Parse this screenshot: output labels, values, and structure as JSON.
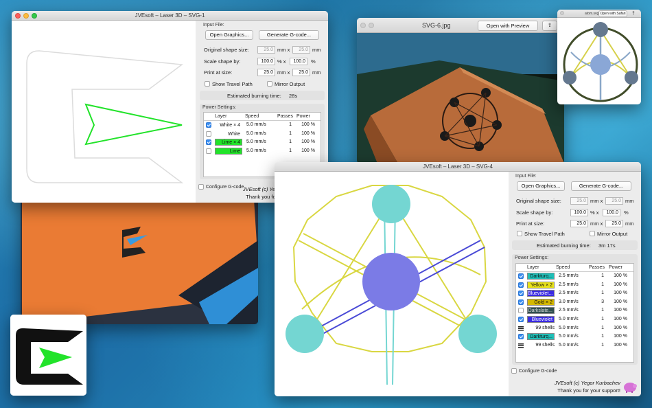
{
  "win1": {
    "title": "JVEsoft – Laser 3D – SVG-1",
    "input_file_label": "Input File:",
    "open_graphics": "Open Graphics...",
    "generate_gcode": "Generate G-code...",
    "original_size_label": "Original shape size:",
    "orig_w": "25.0",
    "orig_h": "25.0",
    "scale_label": "Scale shape by:",
    "scale_x": "100.0",
    "scale_y": "100.0",
    "print_label": "Print at size:",
    "print_w": "25.0",
    "print_h": "25.0",
    "unit_mm": "mm",
    "unit_x": "x",
    "unit_pct": "%",
    "show_travel": "Show Travel Path",
    "mirror": "Mirror Output",
    "burning_label": "Estimated burning time:",
    "burning_value": "28s",
    "power_label": "Power Settings:",
    "col_layer": "Layer",
    "col_speed": "Speed",
    "col_passes": "Passes",
    "col_power": "Power",
    "rows": [
      {
        "checked": true,
        "layer": "White × 4",
        "color": "#ffffff",
        "speed": "5.0 mm/s",
        "passes": "1",
        "power": "100 %"
      },
      {
        "checked": false,
        "layer": "White",
        "color": "#ffffff",
        "speed": "5.0 mm/s",
        "passes": "1",
        "power": "100 %"
      },
      {
        "checked": true,
        "layer": "Lime × 4",
        "color": "#22e32a",
        "speed": "5.0 mm/s",
        "passes": "1",
        "power": "100 %"
      },
      {
        "checked": false,
        "layer": "Lime",
        "color": "#22e32a",
        "speed": "5.0 mm/s",
        "passes": "1",
        "power": "100 %"
      }
    ],
    "configure": "Configure G-code",
    "credit_line1": "JVEsoft (c) Yegor Kurbachev",
    "credit_line2": "Thank you for your support!"
  },
  "preview": {
    "title": "SVG-6.jpg",
    "open_with_preview": "Open with Preview"
  },
  "small": {
    "title": "atom.svg",
    "open_safari": "Open with Safari"
  },
  "win2": {
    "title": "JVEsoft – Laser 3D – SVG-4",
    "input_file_label": "Input File:",
    "open_graphics": "Open Graphics...",
    "generate_gcode": "Generate G-code...",
    "original_size_label": "Original shape size:",
    "orig_w": "25.0",
    "orig_h": "25.0",
    "scale_label": "Scale shape by:",
    "scale_x": "100.0",
    "scale_y": "100.0",
    "print_label": "Print at size:",
    "print_w": "25.0",
    "print_h": "25.0",
    "unit_mm": "mm",
    "unit_x": "x",
    "unit_pct": "%",
    "show_travel": "Show Travel Path",
    "mirror": "Mirror Output",
    "burning_label": "Estimated burning time:",
    "burning_value": "3m 17s",
    "power_label": "Power Settings:",
    "col_layer": "Layer",
    "col_speed": "Speed",
    "col_passes": "Passes",
    "col_power": "Power",
    "rows": [
      {
        "kind": "check",
        "checked": true,
        "layer": "Darkturq...",
        "color": "#1fbfb8",
        "speed": "2.5 mm/s",
        "passes": "1",
        "power": "100 %"
      },
      {
        "kind": "check",
        "checked": true,
        "layer": "Yellow × 2",
        "color": "#e8e21a",
        "speed": "2.5 mm/s",
        "passes": "1",
        "power": "100 %"
      },
      {
        "kind": "check",
        "checked": true,
        "layer": "Blueviolet...",
        "color": "#3a2be2",
        "speed": "2.5 mm/s",
        "passes": "1",
        "power": "100 %"
      },
      {
        "kind": "check",
        "checked": true,
        "layer": "Gold × 2",
        "color": "#d4b800",
        "speed": "3.0 mm/s",
        "passes": "3",
        "power": "100 %"
      },
      {
        "kind": "check",
        "checked": false,
        "layer": "Darkslate...",
        "color": "#2f4f4f",
        "speed": "2.5 mm/s",
        "passes": "1",
        "power": "100 %"
      },
      {
        "kind": "check",
        "checked": true,
        "layer": "Blueviolet",
        "color": "#3a2be2",
        "speed": "5.0 mm/s",
        "passes": "1",
        "power": "100 %"
      },
      {
        "kind": "shells",
        "checked": false,
        "layer": "99 shells",
        "color": "",
        "speed": "5.0 mm/s",
        "passes": "1",
        "power": "100 %"
      },
      {
        "kind": "check",
        "checked": true,
        "layer": "Darkturq...",
        "color": "#1fbfb8",
        "speed": "5.0 mm/s",
        "passes": "1",
        "power": "100 %"
      },
      {
        "kind": "shells",
        "checked": false,
        "layer": "99 shells",
        "color": "",
        "speed": "5.0 mm/s",
        "passes": "1",
        "power": "100 %"
      }
    ],
    "configure": "Configure G-code",
    "credit_line1": "JVEsoft (c) Yegor Kurbachev",
    "credit_line2": "Thank you for your support!"
  },
  "colors": {
    "lime": "#22e32a",
    "turquoise": "#74d6d2",
    "violet": "#7b7be6",
    "yellow": "#d9d742",
    "blue_line": "#4a4ad6"
  }
}
